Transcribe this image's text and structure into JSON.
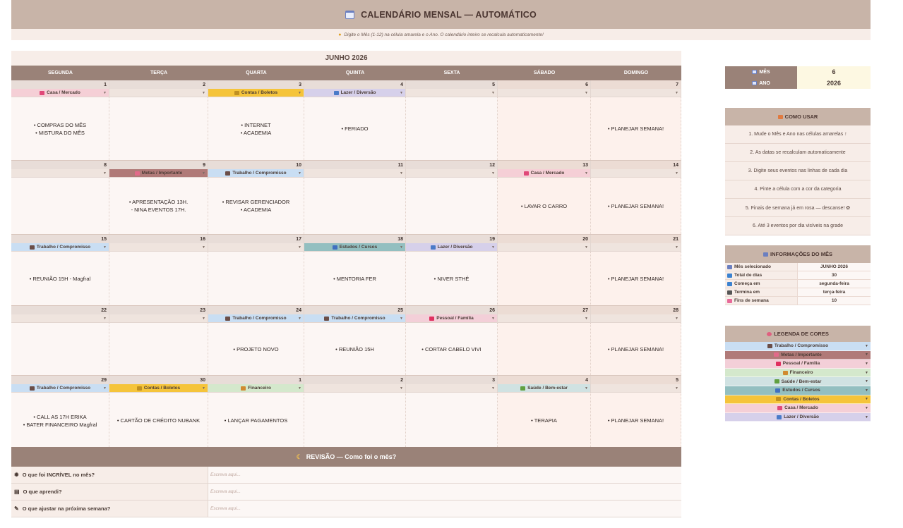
{
  "header": {
    "title": "CALENDÁRIO MENSAL — AUTOMÁTICO",
    "subtitle": "Digite o Mês (1-12) na célula amarela e o Ano. O calendário inteiro se recalcula automaticamente!"
  },
  "calendar": {
    "month_title": "JUNHO  2026",
    "weekdays": [
      "SEGUNDA",
      "TERÇA",
      "QUARTA",
      "QUINTA",
      "SEXTA",
      "SÁBADO",
      "DOMINGO"
    ],
    "weeks": [
      {
        "days": [
          {
            "num": "1",
            "cat": "Casa / Mercado",
            "ev": [
              "• COMPRAS DO MÊS",
              "• MISTURA DO MÊS"
            ]
          },
          {
            "num": "2",
            "cat": "",
            "ev": []
          },
          {
            "num": "3",
            "cat": "Contas / Boletos",
            "ev": [
              "• INTERNET",
              "• ACADEMIA"
            ]
          },
          {
            "num": "4",
            "cat": "Lazer / Diversão",
            "ev": [
              "• FERIADO"
            ]
          },
          {
            "num": "5",
            "cat": "",
            "ev": []
          },
          {
            "num": "6",
            "cat": "",
            "ev": []
          },
          {
            "num": "7",
            "cat": "",
            "ev": [
              "• PLANEJAR SEMANA!"
            ]
          }
        ]
      },
      {
        "days": [
          {
            "num": "8",
            "cat": "",
            "ev": []
          },
          {
            "num": "9",
            "cat": "Metas / Importante",
            "ev": [
              "• APRESENTAÇÃO 13H.",
              "- NINA EVENTOS 17H."
            ]
          },
          {
            "num": "10",
            "cat": "Trabalho / Compromisso",
            "ev": [
              "• REVISAR GERENCIADOR",
              "• ACADEMIA"
            ]
          },
          {
            "num": "11",
            "cat": "",
            "ev": []
          },
          {
            "num": "12",
            "cat": "",
            "ev": []
          },
          {
            "num": "13",
            "cat": "Casa / Mercado",
            "ev": [
              "• LAVAR O CARRO"
            ]
          },
          {
            "num": "14",
            "cat": "",
            "ev": [
              "• PLANEJAR SEMANA!"
            ]
          }
        ]
      },
      {
        "days": [
          {
            "num": "15",
            "cat": "Trabalho / Compromisso",
            "ev": [
              "• REUNIÃO 15H - Magfral"
            ]
          },
          {
            "num": "16",
            "cat": "",
            "ev": []
          },
          {
            "num": "17",
            "cat": "",
            "ev": []
          },
          {
            "num": "18",
            "cat": "Estudos / Cursos",
            "ev": [
              "• MENTORIA FER"
            ]
          },
          {
            "num": "19",
            "cat": "Lazer / Diversão",
            "ev": [
              "• NIVER STHÉ"
            ]
          },
          {
            "num": "20",
            "cat": "",
            "ev": []
          },
          {
            "num": "21",
            "cat": "",
            "ev": [
              "• PLANEJAR SEMANA!"
            ]
          }
        ]
      },
      {
        "days": [
          {
            "num": "22",
            "cat": "",
            "ev": []
          },
          {
            "num": "23",
            "cat": "",
            "ev": []
          },
          {
            "num": "24",
            "cat": "Trabalho / Compromisso",
            "ev": [
              "• PROJETO NOVO"
            ]
          },
          {
            "num": "25",
            "cat": "Trabalho / Compromisso",
            "ev": [
              "• REUNIÃO 15H"
            ]
          },
          {
            "num": "26",
            "cat": "Pessoal / Família",
            "ev": [
              "• CORTAR CABELO VIVI"
            ]
          },
          {
            "num": "27",
            "cat": "",
            "ev": []
          },
          {
            "num": "28",
            "cat": "",
            "ev": [
              "• PLANEJAR SEMANA!"
            ]
          }
        ]
      },
      {
        "days": [
          {
            "num": "29",
            "cat": "Trabalho / Compromisso",
            "ev": [
              "• CALL AS 17H ERIKA",
              "• BATER FINANCEIRO Magfral"
            ]
          },
          {
            "num": "30",
            "cat": "Contas / Boletos",
            "ev": [
              "• CARTÃO DE CRÉDITO NUBANK"
            ]
          },
          {
            "num": "1",
            "cat": "Financeiro",
            "ev": [
              "• LANÇAR PAGAMENTOS"
            ]
          },
          {
            "num": "2",
            "cat": "",
            "ev": []
          },
          {
            "num": "3",
            "cat": "",
            "ev": []
          },
          {
            "num": "4",
            "cat": "Saúde / Bem-estar",
            "ev": [
              "• TERAPIA"
            ]
          },
          {
            "num": "5",
            "cat": "",
            "ev": [
              "• PLANEJAR SEMANA!"
            ]
          }
        ]
      }
    ]
  },
  "categories": [
    {
      "name": "Trabalho / Compromisso",
      "color": "#c9def3",
      "icon": "#6b4e48"
    },
    {
      "name": "Metas / Importante",
      "color": "#b07a78",
      "icon": "#e26a8a"
    },
    {
      "name": "Pessoal / Família",
      "color": "#f3cfd8",
      "icon": "#e03060"
    },
    {
      "name": "Financeiro",
      "color": "#d4e8cc",
      "icon": "#d08a30"
    },
    {
      "name": "Saúde / Bem-estar",
      "color": "#d0e2e2",
      "icon": "#60a040"
    },
    {
      "name": "Estudos / Cursos",
      "color": "#93bfc0",
      "icon": "#4070c0"
    },
    {
      "name": "Contas / Boletos",
      "color": "#f5c43a",
      "icon": "#c09020"
    },
    {
      "name": "Casa / Mercado",
      "color": "#f5cfd6",
      "icon": "#e04878"
    },
    {
      "name": "Lazer / Diversão",
      "color": "#d6d0ea",
      "icon": "#4a7ac8"
    }
  ],
  "month_year": {
    "mes_label": "MÊS",
    "mes_value": "6",
    "ano_label": "ANO",
    "ano_value": "2026"
  },
  "howto": {
    "title": "COMO USAR",
    "items": [
      "1. Mude o Mês e Ano nas células amarelas ↑",
      "2. As datas se recalculam automaticamente",
      "3. Digite seus eventos nas linhas de cada dia",
      "4. Pinte a célula com a cor da categoria",
      "5. Finais de semana já em rosa — descanse! ✿",
      "6. Até 3 eventos por dia visíveis na grade"
    ]
  },
  "info": {
    "title": "INFORMAÇÕES DO MÊS",
    "rows": [
      {
        "k": "Mês selecionado",
        "v": "JUNHO 2026",
        "c": "#6b7fc0"
      },
      {
        "k": "Total de dias",
        "v": "30",
        "c": "#3b82d0"
      },
      {
        "k": "Começa em",
        "v": "segunda-feira",
        "c": "#3b82d0"
      },
      {
        "k": "Termina em",
        "v": "terça-feira",
        "c": "#555555"
      },
      {
        "k": "Fins de semana",
        "v": "10",
        "c": "#e86a9a"
      }
    ]
  },
  "legend": {
    "title": "LEGENDA DE CORES"
  },
  "review": {
    "title": "REVISÃO — Como foi o mês?",
    "placeholder": "Escreva aqui...",
    "questions": [
      {
        "q": "O que foi INCRÍVEL no mês?",
        "icon": "✹"
      },
      {
        "q": "O que aprendi?",
        "icon": "▤"
      },
      {
        "q": "O que ajustar na próxima semana?",
        "icon": "✎"
      }
    ]
  },
  "colors": {
    "weekend": "#fdf1ec",
    "weekday": "#fcf6f4",
    "header": "#9a8278"
  }
}
